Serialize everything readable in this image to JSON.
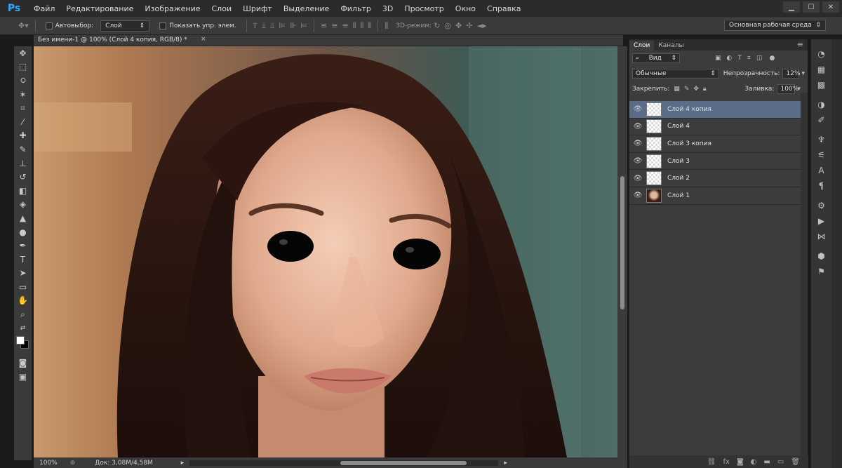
{
  "app": {
    "logo": "Ps"
  },
  "menu": [
    "Файл",
    "Редактирование",
    "Изображение",
    "Слои",
    "Шрифт",
    "Выделение",
    "Фильтр",
    "3D",
    "Просмотр",
    "Окно",
    "Справка"
  ],
  "window_controls": {
    "minimize": "▁",
    "maximize": "☐",
    "close": "✕"
  },
  "options": {
    "autoselect_label": "Автовыбор:",
    "autoselect_value": "Слой",
    "show_controls_label": "Показать упр. элем.",
    "mode3d_label": "3D-режим:",
    "workspace": "Основная рабочая среда"
  },
  "document": {
    "tab_title": "Без имени-1 @ 100% (Слой 4 копия, RGB/8) *",
    "tab_close": "×",
    "zoom": "100%",
    "doc_size": "Док: 3,08M/4,58M"
  },
  "panels": {
    "tabs": [
      "Слои",
      "Каналы"
    ],
    "filter_label": "Вид",
    "blend_mode": "Обычные",
    "opacity_label": "Непрозрачность:",
    "opacity_value": "12%",
    "lock_label": "Закрепить:",
    "fill_label": "Заливка:",
    "fill_value": "100%",
    "layers": [
      {
        "name": "Слой 4 копия",
        "selected": true,
        "thumb": "transparent"
      },
      {
        "name": "Слой 4",
        "selected": false,
        "thumb": "transparent"
      },
      {
        "name": "Слой 3 копия",
        "selected": false,
        "thumb": "transparent"
      },
      {
        "name": "Слой 3",
        "selected": false,
        "thumb": "transparent"
      },
      {
        "name": "Слой 2",
        "selected": false,
        "thumb": "transparent"
      },
      {
        "name": "Слой 1",
        "selected": false,
        "thumb": "photo"
      }
    ]
  },
  "colors": {
    "selected_layer": "#5a6c87",
    "ps_blue": "#31a8ff",
    "bg_panel": "#3c3c3c"
  }
}
